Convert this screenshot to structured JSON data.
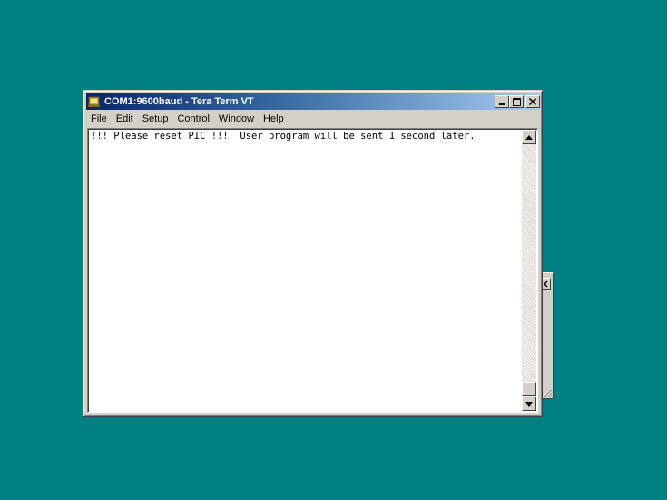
{
  "window": {
    "title": "COM1:9600baud - Tera Term VT"
  },
  "menu": {
    "items": [
      "File",
      "Edit",
      "Setup",
      "Control",
      "Window",
      "Help"
    ]
  },
  "terminal": {
    "line1": "!!! Please reset PIC !!!  User program will be sent 1 second later."
  },
  "colors": {
    "desktop": "#008080",
    "titlebar_start": "#0a246a",
    "titlebar_end": "#a6caf0"
  },
  "icons": {
    "app": "tera-term-icon",
    "minimize": "minimize-icon",
    "maximize": "maximize-icon",
    "close": "close-icon",
    "scroll_up": "arrow-up-icon",
    "scroll_down": "arrow-down-icon"
  }
}
